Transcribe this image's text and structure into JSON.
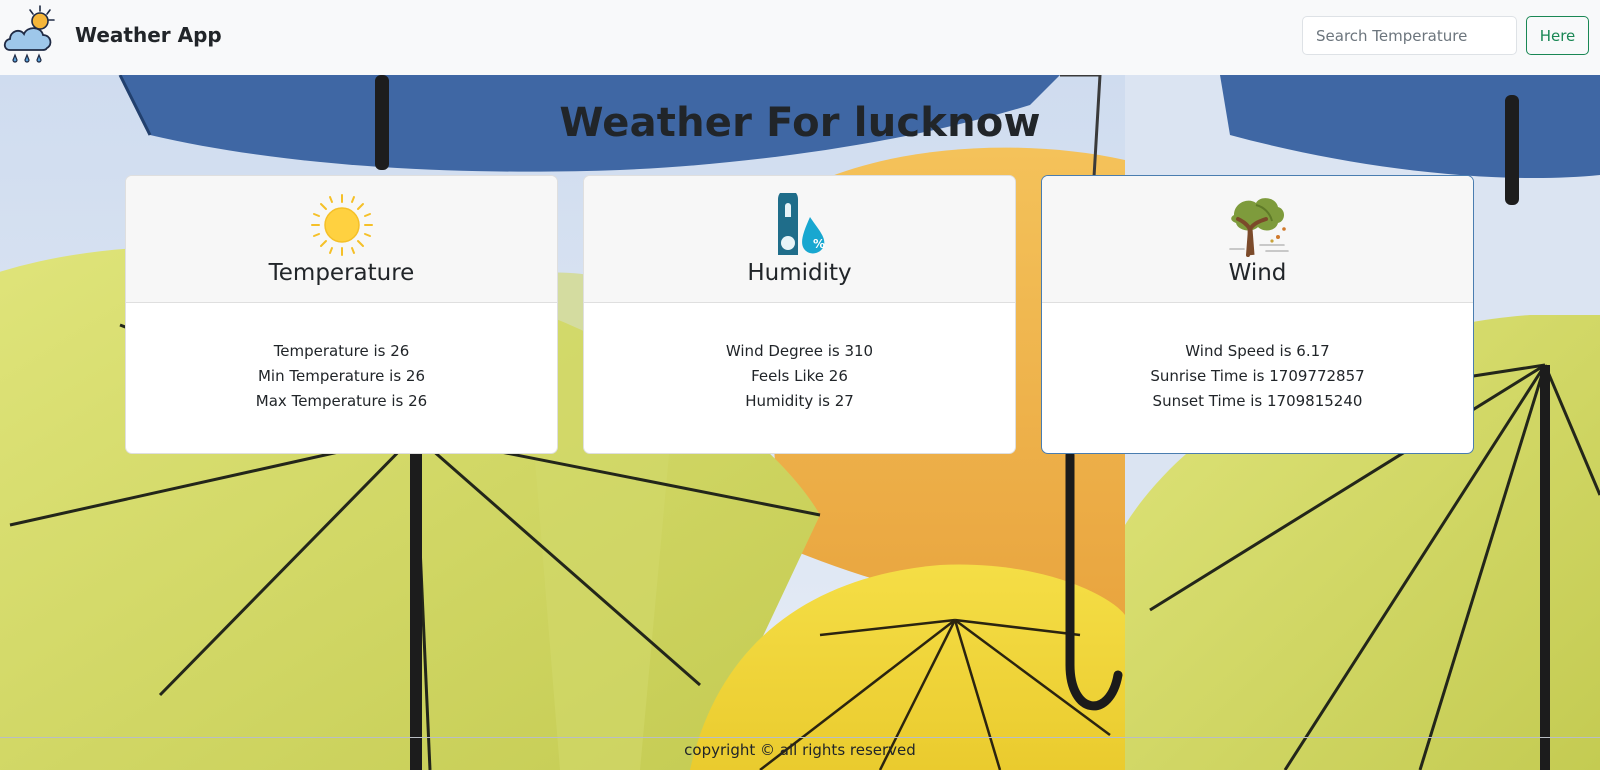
{
  "navbar": {
    "brand_name": "Weather App",
    "logo_icon": "cloud-sun-rain-icon",
    "search": {
      "placeholder": "Search Temperature",
      "value": ""
    },
    "submit_label": "Here"
  },
  "page": {
    "title": "Weather For lucknow"
  },
  "cards": [
    {
      "title": "Temperature",
      "icon": "sun-icon",
      "lines": [
        "Temperature is 26",
        "Min Temperature is 26",
        "Max Temperature is 26"
      ]
    },
    {
      "title": "Humidity",
      "icon": "thermometer-humidity-icon",
      "lines": [
        "Wind Degree is 310",
        "Feels Like 26",
        "Humidity is 27"
      ]
    },
    {
      "title": "Wind",
      "icon": "windy-tree-icon",
      "lines": [
        "Wind Speed is 6.17",
        "Sunrise Time is 1709772857",
        "Sunset Time is 1709815240"
      ]
    }
  ],
  "footer": {
    "text": "copyright © all rights reserved"
  },
  "colors": {
    "navbar_bg": "#f8f9fa",
    "accent_green": "#198754",
    "umbrella_yellow": "#d6dd6a",
    "umbrella_orange": "#eeae4a",
    "umbrella_blue": "#3c64a0",
    "sky": "#d9e3f1"
  }
}
